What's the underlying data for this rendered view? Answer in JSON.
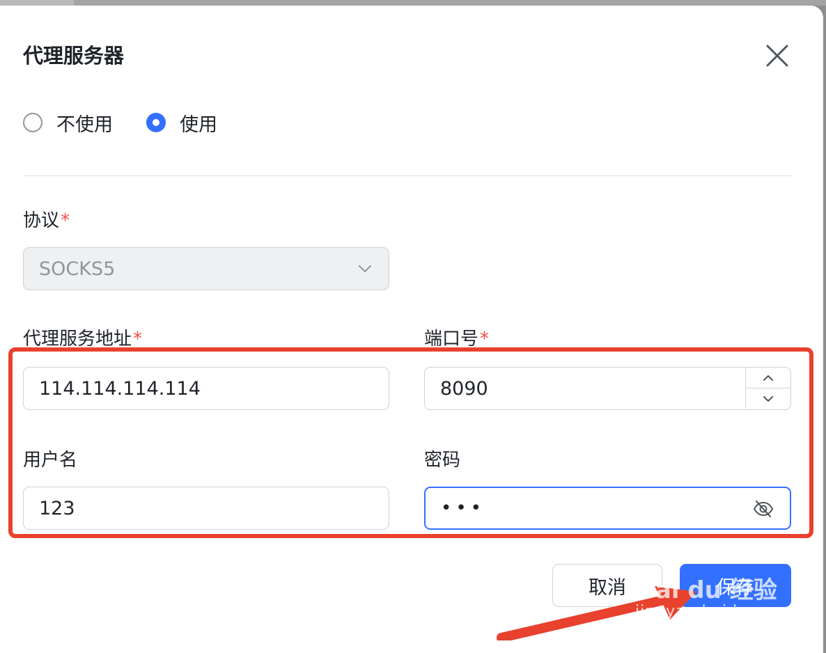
{
  "dialog": {
    "title": "代理服务器"
  },
  "mode": {
    "options": [
      {
        "label": "不使用",
        "selected": false
      },
      {
        "label": "使用",
        "selected": true
      }
    ]
  },
  "protocol": {
    "label": "协议",
    "required_mark": "*",
    "value": "SOCKS5"
  },
  "address": {
    "label": "代理服务地址",
    "required_mark": "*",
    "value": "114.114.114.114"
  },
  "port": {
    "label": "端口号",
    "required_mark": "*",
    "value": "8090"
  },
  "username": {
    "label": "用户名",
    "value": "123"
  },
  "password": {
    "label": "密码",
    "masked_value": "•••"
  },
  "buttons": {
    "cancel": "取消",
    "save": "保存"
  },
  "watermark": {
    "brand": "Bai du 经验",
    "url": "jingyan.baidu.com"
  },
  "colors": {
    "accent": "#3370ff",
    "highlight_box": "#e8412e",
    "required": "#f54a45"
  }
}
